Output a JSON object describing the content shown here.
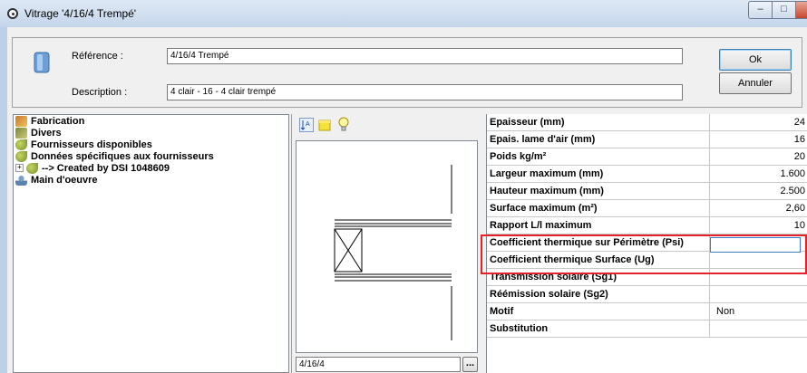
{
  "window": {
    "title": "Vitrage '4/16/4 Trempé'",
    "min_label": "–",
    "max_label": "□",
    "close_label": "X"
  },
  "header": {
    "reference_label": "Référence :",
    "reference_value": "4/16/4 Trempé",
    "description_label": "Description :",
    "description_value": "4 clair - 16 - 4 clair trempé",
    "ok_label": "Ok",
    "cancel_label": "Annuler"
  },
  "tree": {
    "items": [
      {
        "label": "Fabrication",
        "icon": "fabrication-icon"
      },
      {
        "label": "Divers",
        "icon": "divers-icon"
      },
      {
        "label": "Fournisseurs disponibles",
        "icon": "suppliers-icon"
      },
      {
        "label": "Données spécifiques aux fournisseurs",
        "icon": "supplier-data-icon"
      },
      {
        "label": "--> Created by DSI 1048609",
        "icon": "created-icon"
      },
      {
        "label": "Main d'oeuvre",
        "icon": "labour-icon"
      }
    ]
  },
  "preview": {
    "code_value": "4/16/4",
    "browse_label": "..."
  },
  "properties": {
    "rows": [
      {
        "name": "Epaisseur (mm)",
        "value": "24"
      },
      {
        "name": "Epais. lame d'air (mm)",
        "value": "16"
      },
      {
        "name": "Poids kg/m²",
        "value": "20"
      },
      {
        "name": "Largeur maximum (mm)",
        "value": "1.600"
      },
      {
        "name": "Hauteur maximum (mm)",
        "value": "2.500"
      },
      {
        "name": "Surface maximum (m²)",
        "value": "2,60"
      },
      {
        "name": "Rapport L/l maximum",
        "value": "10"
      },
      {
        "name": "Coefficient thermique sur Périmètre (Psi)",
        "value": ""
      },
      {
        "name": "Coefficient thermique Surface (Ug)",
        "value": ""
      },
      {
        "name": "Transmission solaire (Sg1)",
        "value": ""
      },
      {
        "name": "Réémission solaire (Sg2)",
        "value": ""
      },
      {
        "name": "Motif",
        "value": "Non"
      },
      {
        "name": "Substitution",
        "value": ""
      }
    ]
  },
  "colors": {
    "highlight": "#e32229",
    "edit_border": "#3d7bd1"
  }
}
